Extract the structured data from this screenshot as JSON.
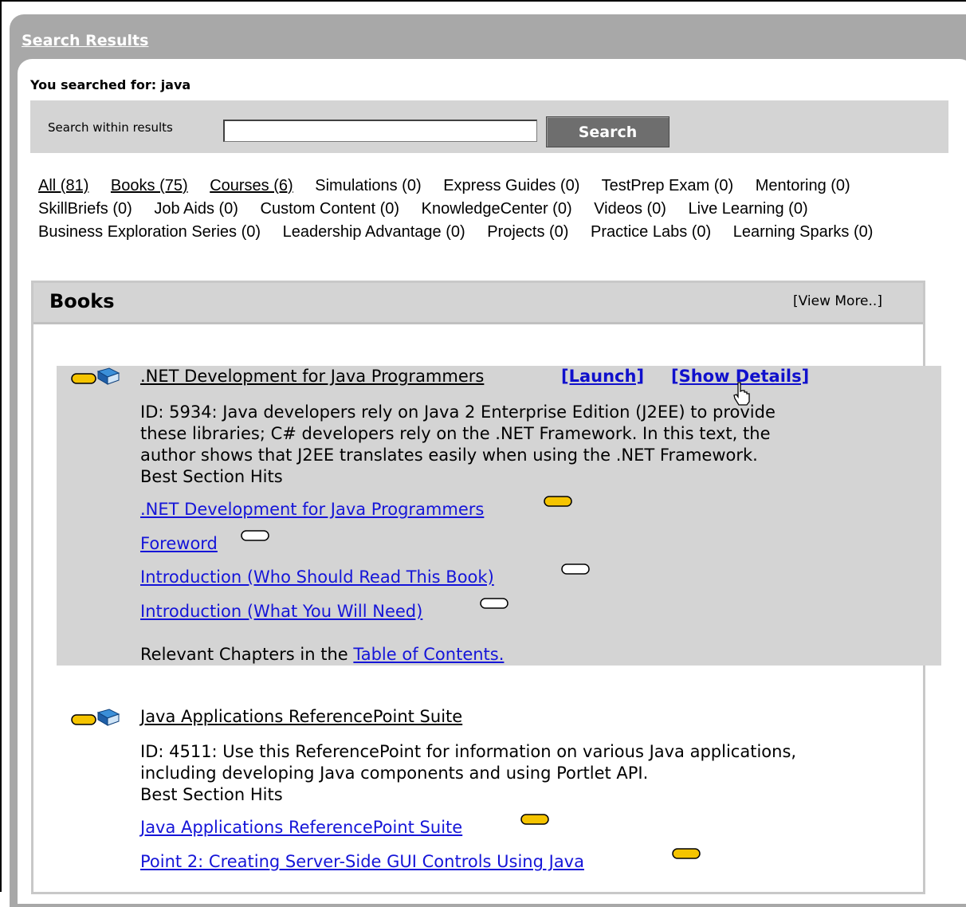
{
  "header": {
    "title": "Search Results"
  },
  "search": {
    "searched_for": "You searched for: java",
    "within_label": "Search within results",
    "input_value": "",
    "button_label": "Search"
  },
  "filters": [
    "All (81)",
    "Books (75)",
    "Courses (6)",
    "Simulations (0)",
    "Express Guides (0)",
    "TestPrep Exam (0)",
    "Mentoring (0)",
    "SkillBriefs (0)",
    "Job Aids (0)",
    "Custom Content (0)",
    "KnowledgeCenter (0)",
    "Videos (0)",
    "Live Learning (0)",
    "Business Exploration Series (0)",
    "Leadership Advantage (0)",
    "Projects (0)",
    "Practice Labs (0)",
    "Learning Sparks (0)"
  ],
  "books": {
    "title": "Books",
    "view_more": "[View More..]",
    "items": [
      {
        "title": ".NET Development for Java Programmers",
        "launch": "[Launch]",
        "show_details": "[Show Details]",
        "desc_line1": "ID: 5934: Java developers rely on Java 2 Enterprise Edition (J2EE) to provide",
        "desc_line2": "these libraries; C# developers rely on the .NET Framework. In this text, the",
        "desc_line3": "author shows that J2EE translates easily when using the .NET Framework.",
        "best_hits": "Best Section Hits",
        "hits": [
          ".NET Development for Java Programmers",
          "Foreword",
          "Introduction (Who Should Read This Book)",
          "Introduction (What You Will Need)"
        ],
        "toc_prefix": "Relevant Chapters in the ",
        "toc_link": "Table of Contents."
      },
      {
        "title": "Java Applications ReferencePoint Suite",
        "desc_line1": "ID: 4511: Use this ReferencePoint for information on various Java applications,",
        "desc_line2": "including developing Java components and using Portlet API.",
        "best_hits": "Best Section Hits",
        "hits": [
          "Java Applications ReferencePoint Suite",
          "Point 2: Creating Server-Side GUI Controls Using Java"
        ]
      }
    ]
  },
  "colors": {
    "link": "#1515d8",
    "panel_gray": "#a8a8a8",
    "highlight_gray": "#d4d4d4",
    "pill_gold": "#f5c400"
  }
}
